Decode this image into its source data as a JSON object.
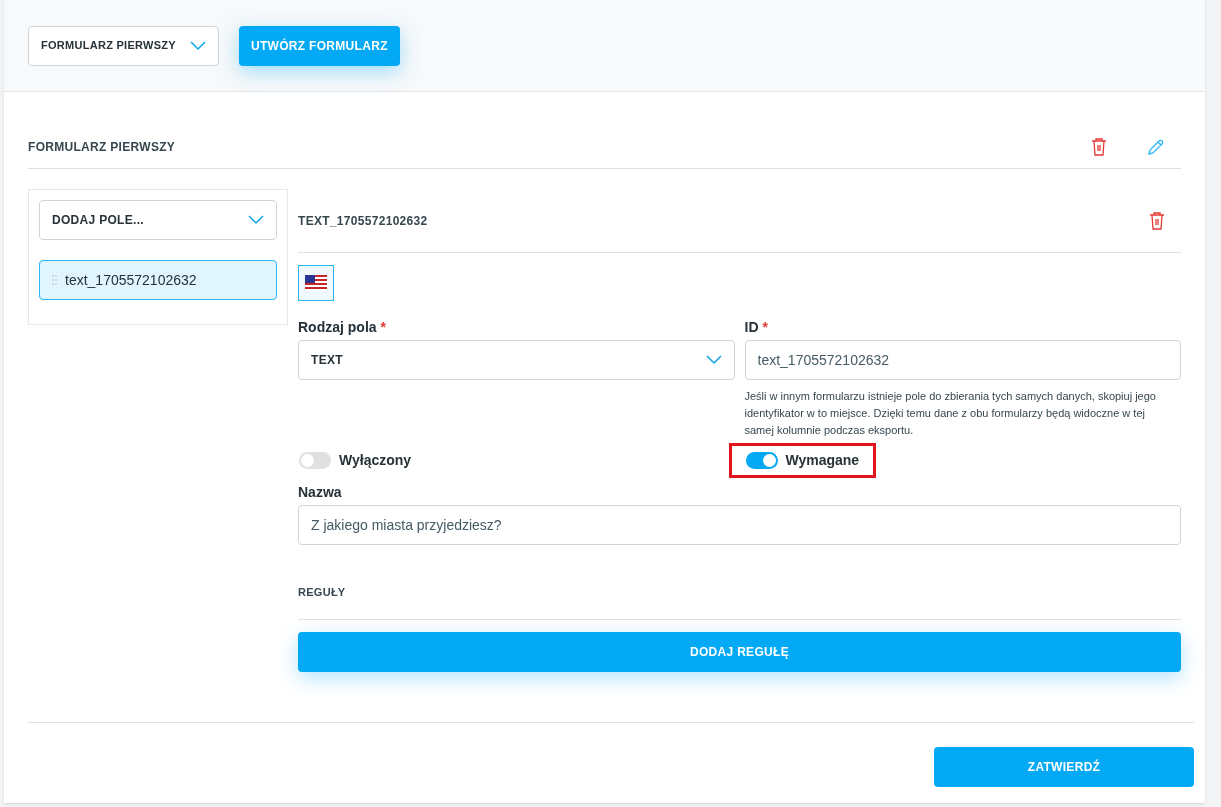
{
  "toolbar": {
    "form_select": {
      "value": "FORMULARZ PIERWSZY"
    },
    "create_button": "UTWÓRZ FORMULARZ"
  },
  "form": {
    "title": "FORMULARZ PIERWSZY",
    "sidebar": {
      "add_field_select": {
        "value": "DODAJ POLE..."
      },
      "fields": [
        {
          "label": "text_1705572102632",
          "selected": true
        }
      ]
    },
    "editor": {
      "title": "TEXT_1705572102632",
      "language": {
        "selected": true
      },
      "field_type": {
        "label": "Rodzaj pola",
        "required_mark": "*",
        "value": "TEXT"
      },
      "id_field": {
        "label": "ID",
        "required_mark": "*",
        "value": "text_1705572102632",
        "hint": "Jeśli w innym formularzu istnieje pole do zbierania tych samych danych, skopiuj jego identyfikator w to miejsce. Dzięki temu dane z obu formularzy będą widoczne w tej samej kolumnie podczas eksportu."
      },
      "toggles": [
        {
          "label": "Wyłączony",
          "on": false,
          "highlighted": false
        },
        {
          "label": "Wymagane",
          "on": true,
          "highlighted": true
        }
      ],
      "name_field": {
        "label": "Nazwa",
        "value": "Z jakiego miasta przyjedziesz?"
      },
      "rules": {
        "title": "REGUŁY",
        "add_button": "DODAJ REGUŁĘ"
      }
    }
  },
  "submit_button": "ZATWIERDŹ"
}
